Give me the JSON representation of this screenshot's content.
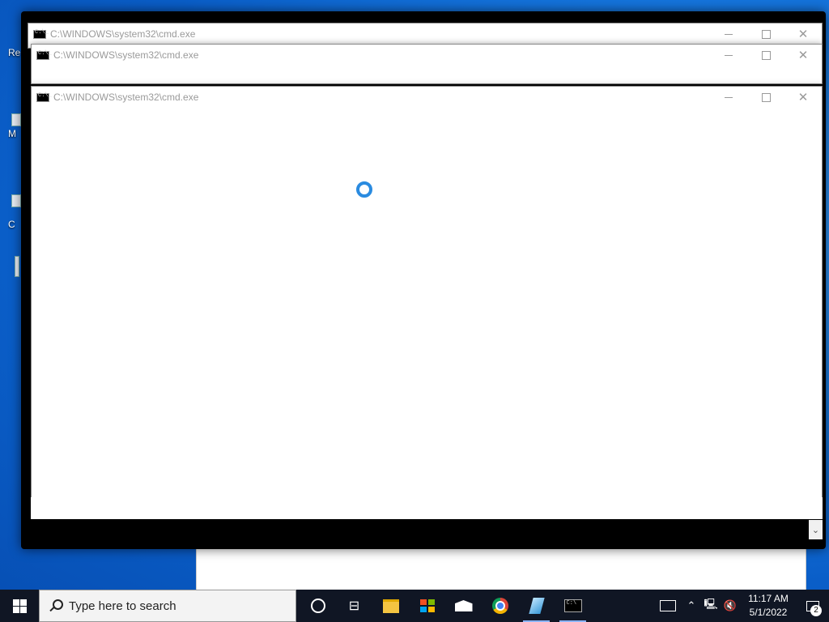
{
  "desktop": {
    "icons": [
      {
        "label": "Re"
      },
      {
        "label": "M"
      },
      {
        "label": "C"
      }
    ]
  },
  "windows": [
    {
      "title": "C:\\WINDOWS\\system32\\cmd.exe"
    },
    {
      "title": "C:\\WINDOWS\\system32\\cmd.exe"
    },
    {
      "title": "C:\\WINDOWS\\system32\\cmd.exe"
    }
  ],
  "window_controls": {
    "minimize": "—",
    "maximize": "☐",
    "close": "✕"
  },
  "taskbar": {
    "search_placeholder": "Type here to search",
    "apps": [
      {
        "name": "cortana-icon"
      },
      {
        "name": "task-view-icon"
      },
      {
        "name": "file-explorer-icon"
      },
      {
        "name": "microsoft-store-icon"
      },
      {
        "name": "mail-icon"
      },
      {
        "name": "chrome-icon"
      },
      {
        "name": "notepad-plus-icon"
      },
      {
        "name": "command-prompt-icon"
      }
    ],
    "time": "11:17 AM",
    "date": "5/1/2022",
    "notification_count": "2"
  },
  "colors": {
    "accent": "#2a8be0",
    "taskbar": "#101624",
    "desktop": "#1a7fe6"
  }
}
